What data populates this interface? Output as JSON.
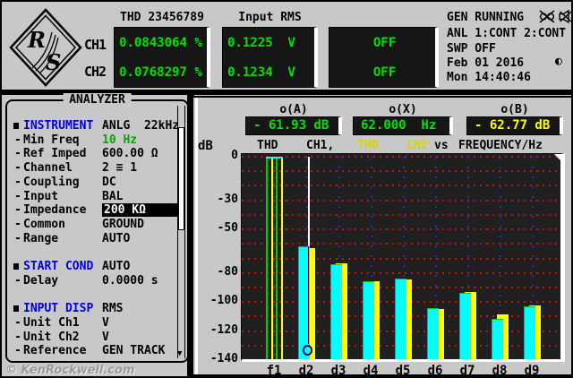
{
  "header": {
    "logo": {
      "letter_top": "R",
      "letter_bottom": "S"
    },
    "channel_labels": [
      "CH1",
      "CH2"
    ],
    "meters": [
      {
        "title": "THD 23456789",
        "rows": [
          "0.0843064 %",
          "0.0768297 %"
        ],
        "center": false
      },
      {
        "title": "Input RMS",
        "rows": [
          "0.1225  V",
          "0.1234  V"
        ],
        "center": false
      },
      {
        "title": "",
        "rows": [
          "OFF",
          "OFF"
        ],
        "center": true
      }
    ],
    "meter_text_color": "#00e000",
    "status": {
      "gen": "GEN RUNNING",
      "anl": "ANL 1:CONT 2:CONT",
      "swp": "SWP OFF",
      "date": "Feb 01 2016",
      "time": "Mon 14:40:46",
      "half_circle_glyph": "◐"
    }
  },
  "analyzer": {
    "title": "ANALYZER",
    "rows": [
      {
        "type": "group",
        "label": "INSTRUMENT",
        "value": "ANLG  22kHz"
      },
      {
        "type": "item",
        "label": "Min Freq",
        "value": "10 Hz",
        "value_color": "#00a800"
      },
      {
        "type": "item",
        "label": "Ref Imped",
        "value": "600.00 Ω"
      },
      {
        "type": "item",
        "label": "Channel",
        "value": "2 ≡ 1"
      },
      {
        "type": "item",
        "label": "Coupling",
        "value": "DC"
      },
      {
        "type": "item",
        "label": "Input",
        "value": "BAL"
      },
      {
        "type": "item",
        "label": "Impedance",
        "value": "200 KΩ",
        "highlight": true
      },
      {
        "type": "item",
        "label": "Common",
        "value": "GROUND"
      },
      {
        "type": "item",
        "label": "Range",
        "value": "AUTO"
      },
      {
        "type": "spacer"
      },
      {
        "type": "group",
        "label": "START COND",
        "value": "AUTO"
      },
      {
        "type": "item",
        "label": "Delay",
        "value": "0.0000 s"
      },
      {
        "type": "spacer"
      },
      {
        "type": "group",
        "label": "INPUT DISP",
        "value": "RMS"
      },
      {
        "type": "item",
        "label": "Unit Ch1",
        "value": "V"
      },
      {
        "type": "item",
        "label": "Unit Ch2",
        "value": "V"
      },
      {
        "type": "item",
        "label": "Reference",
        "value": "GEN TRACK"
      }
    ],
    "group_label_color": "#0000dd",
    "scroll_arrow": "▼"
  },
  "graph": {
    "cursor_readouts": [
      {
        "label": "o(A)",
        "value": "- 61.93 dB",
        "color": "#00e000"
      },
      {
        "label": "o(X)",
        "value": "62.000  Hz",
        "color": "#00e000"
      },
      {
        "label": "o(B)",
        "value": "- 62.77 dB",
        "color": "#ffff00"
      }
    ],
    "axis_unit": "dB",
    "legend": [
      {
        "text": "THD",
        "color": "#000000"
      },
      {
        "text": "CH1,",
        "color": "#000000"
      },
      {
        "text": "THD",
        "color": "#d4d400"
      },
      {
        "text": "CH2",
        "color": "#d4d400"
      },
      {
        "text": "vs",
        "color": "#000000"
      },
      {
        "text": "FREQUENCY/Hz",
        "color": "#000000"
      }
    ]
  },
  "chart_data": {
    "type": "bar",
    "title": "THD CH1, THD CH2 vs FREQUENCY/Hz",
    "ylabel": "dB",
    "ylim": [
      -140,
      0
    ],
    "ytick_values": [
      0,
      -30,
      -50,
      -80,
      -100,
      -120,
      -140
    ],
    "grid_step_db": 10,
    "grid_on": true,
    "categories": [
      "f1",
      "d2",
      "d3",
      "d4",
      "d5",
      "d6",
      "d7",
      "d8",
      "d9"
    ],
    "series": [
      {
        "name": "THD CH1",
        "color": "#00ffff",
        "edge_color": "#00cc00",
        "values": [
          0,
          -61.93,
          -74.0,
          -86.0,
          -84.0,
          -104.0,
          -94.0,
          -111.5,
          -103.0
        ]
      },
      {
        "name": "THD CH2",
        "color": "#ffff00",
        "values": [
          0,
          -62.77,
          -73.6,
          -85.6,
          -84.3,
          -104.6,
          -93.3,
          -108.5,
          -102.4
        ]
      }
    ],
    "fundamental_outline_only": true,
    "cursor": {
      "category_index": 1,
      "a_value": "- 61.93 dB",
      "b_value": "- 62.77 dB",
      "x_value": "62.000 Hz"
    },
    "grid_color": "#cc1111",
    "plot_bg": "#202020"
  },
  "watermark": "© KenRockwell.com"
}
